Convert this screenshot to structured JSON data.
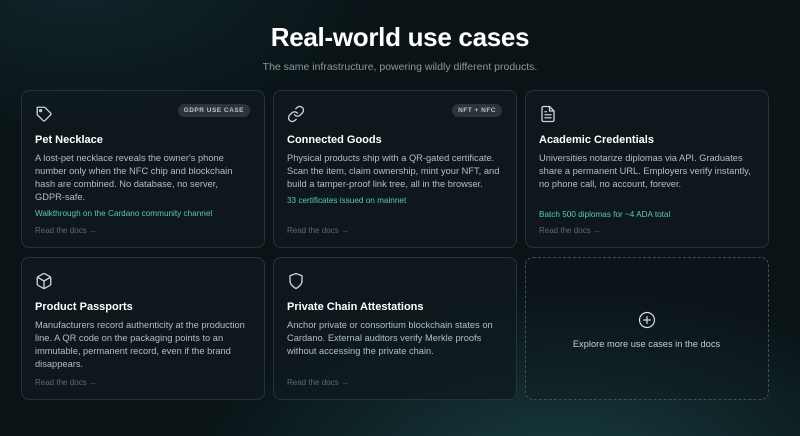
{
  "header": {
    "title": "Real-world use cases",
    "subtitle": "The same infrastructure, powering wildly different products."
  },
  "cards": [
    {
      "icon": "tag-icon",
      "badge": "GDPR USE CASE",
      "title": "Pet Necklace",
      "description": "A lost-pet necklace reveals the owner's phone number only when the NFC chip and blockchain hash are combined. No database, no server, GDPR-safe.",
      "highlight": "Walkthrough on the Cardano community channel",
      "link": "Read the docs →"
    },
    {
      "icon": "link-icon",
      "badge": "NFT + NFC",
      "title": "Connected Goods",
      "description": "Physical products ship with a QR-gated certificate. Scan the item, claim ownership, mint your NFT, and build a tamper-proof link tree, all in the browser.",
      "highlight": "33 certificates issued on mainnet",
      "link": "Read the docs →"
    },
    {
      "icon": "document-icon",
      "badge": "",
      "title": "Academic Credentials",
      "description": "Universities notarize diplomas via API. Graduates share a permanent URL. Employers verify instantly, no phone call, no account, forever.",
      "highlight": "Batch 500 diplomas for ~4 ADA total",
      "link": "Read the docs →"
    },
    {
      "icon": "box-icon",
      "badge": "",
      "title": "Product Passports",
      "description": "Manufacturers record authenticity at the production line. A QR code on the packaging points to an immutable, permanent record, even if the brand disappears.",
      "highlight": "",
      "link": "Read the docs →"
    },
    {
      "icon": "shield-icon",
      "badge": "",
      "title": "Private Chain Attestations",
      "description": "Anchor private or consortium blockchain states on Cardano. External auditors verify Merkle proofs without accessing the private chain.",
      "highlight": "",
      "link": "Read the docs →"
    }
  ],
  "explore": {
    "icon": "plus-circle-icon",
    "label": "Explore more use cases in the docs"
  }
}
